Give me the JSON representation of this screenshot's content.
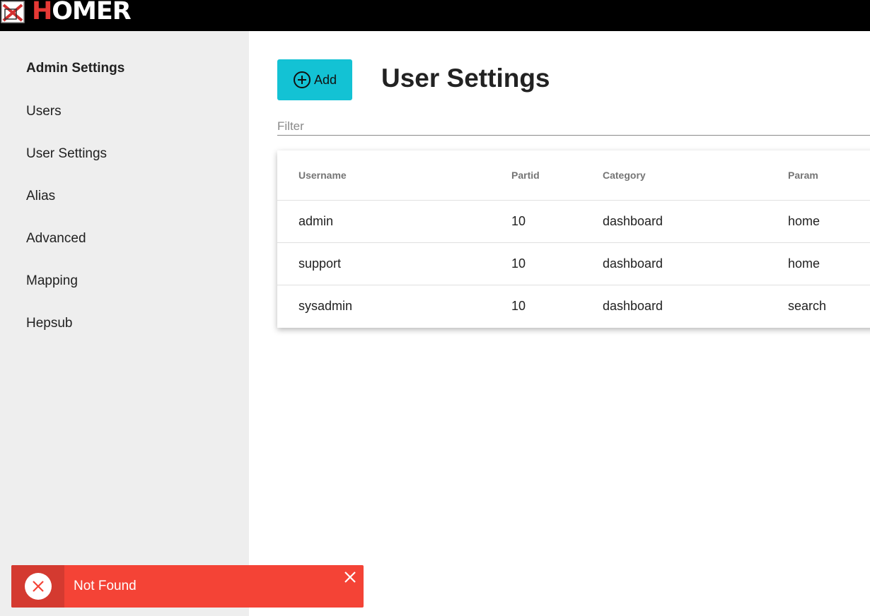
{
  "header": {
    "logo_first": "H",
    "logo_rest": "OMER"
  },
  "sidebar": {
    "items": [
      {
        "label": "Admin Settings"
      },
      {
        "label": "Users"
      },
      {
        "label": "User Settings"
      },
      {
        "label": "Alias"
      },
      {
        "label": "Advanced"
      },
      {
        "label": "Mapping"
      },
      {
        "label": "Hepsub"
      }
    ]
  },
  "main": {
    "add_label": "Add",
    "title": "User Settings",
    "filter_placeholder": "Filter",
    "filter_value": ""
  },
  "table": {
    "columns": [
      "Username",
      "Partid",
      "Category",
      "Param"
    ],
    "rows": [
      [
        "admin",
        "10",
        "dashboard",
        "home"
      ],
      [
        "support",
        "10",
        "dashboard",
        "home"
      ],
      [
        "sysadmin",
        "10",
        "dashboard",
        "search"
      ]
    ]
  },
  "toast": {
    "message": "Not Found"
  },
  "colors": {
    "topbar": "#000000",
    "logo_accent": "#e53935",
    "sidebar": "#eeeeee",
    "add_button": "#13c2d4",
    "toast": "#f44336",
    "toast_icon_bg": "#d43a30"
  },
  "icons": {
    "logo": "homer-logo-icon",
    "add": "plus-circle-icon",
    "toast": "error-x-icon",
    "toast_close": "close-icon"
  }
}
